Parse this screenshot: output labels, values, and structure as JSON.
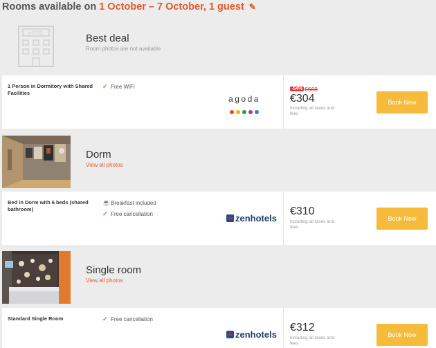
{
  "header": {
    "prefix": "Rooms available on",
    "dates": "1 October – 7 October, 1 guest",
    "edit_icon": "pencil-icon"
  },
  "rooms": [
    {
      "title": "Best deal",
      "subtitle": "Room photos are not available",
      "thumbnail": "hotel-placeholder-icon",
      "offer": {
        "name": "1 Person in Dormitory with Shared Facilities",
        "features": [
          {
            "icon": "check-icon",
            "label": "Free WiFi"
          }
        ],
        "provider": "agoda",
        "discount": "-54%",
        "old_price": "€668",
        "price": "€304",
        "taxes": "including all taxes and fees",
        "book_label": "Book Now"
      }
    },
    {
      "title": "Dorm",
      "subtitle": "View all photos",
      "thumbnail": "dorm-photo",
      "offer": {
        "name": "Bed in Dorm with 6 beds (shared bathroom)",
        "features": [
          {
            "icon": "breakfast-icon",
            "label": "Breakfast included"
          },
          {
            "icon": "check-icon",
            "label": "Free cancellation"
          }
        ],
        "provider": "zenhotels",
        "price": "€310",
        "taxes": "including all taxes and fees",
        "book_label": "Book Now"
      }
    },
    {
      "title": "Single room",
      "subtitle": "View all photos",
      "thumbnail": "single-room-photo",
      "offer": {
        "name": "Standard Single Room",
        "features": [
          {
            "icon": "check-icon",
            "label": "Free cancellation"
          }
        ],
        "provider": "zenhotels",
        "price": "€312",
        "taxes": "including all taxes and fees",
        "book_label": "Book Now"
      }
    }
  ],
  "providers": {
    "agoda": {
      "word": "agoda",
      "dot_colors": [
        "#e8453c",
        "#f4b400",
        "#2e9e48",
        "#8e44ad",
        "#3b7dd8"
      ]
    },
    "zenhotels": {
      "word": "zenhotels"
    }
  },
  "colors": {
    "accent": "#e05a2b",
    "button": "#f6bb3b",
    "check": "#4caf50",
    "discount": "#e03030"
  }
}
